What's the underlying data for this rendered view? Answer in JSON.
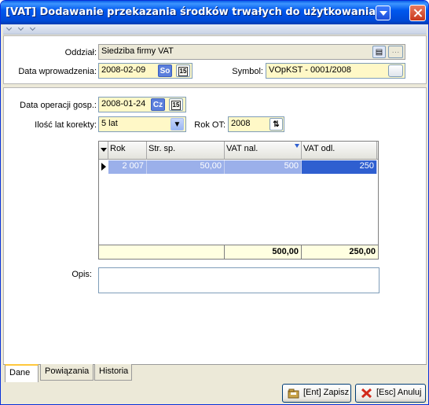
{
  "window": {
    "title": "[VAT] Dodawanie przekazania środków trwałych do użytkowania z inwestycji"
  },
  "header": {
    "oddzial_label": "Oddział:",
    "oddzial_value": "Siedziba firmy VAT",
    "data_wprowadzenia_label": "Data wprowadzenia:",
    "data_wprowadzenia_value": "2008-02-09",
    "data_wprowadzenia_tag": "So",
    "symbol_label": "Symbol:",
    "symbol_value": "VOpKST - 0001/2008"
  },
  "main": {
    "data_operacji_label": "Data operacji gosp.:",
    "data_operacji_value": "2008-01-24",
    "data_operacji_tag": "Cz",
    "ilosc_lat_label": "Ilość lat korekty:",
    "ilosc_lat_value": "5 lat",
    "rok_ot_label": "Rok OT:",
    "rok_ot_value": "2008",
    "opis_label": "Opis:",
    "opis_value": ""
  },
  "grid": {
    "columns": [
      "Rok",
      "Str. sp.",
      "VAT nal.",
      "VAT odl."
    ],
    "rows": [
      {
        "rok": "2 007",
        "str_sp": "50,00",
        "vat_nal": "500",
        "vat_odl": "250"
      }
    ],
    "totals": {
      "vat_nal": "500,00",
      "vat_odl": "250,00"
    }
  },
  "tabs": [
    "Dane",
    "Powiązania",
    "Historia"
  ],
  "buttons": {
    "save": "[Ent] Zapisz",
    "cancel": "[Esc] Anuluj"
  },
  "colors": {
    "titlebar": "#0058ee",
    "required_field": "#fff8c7",
    "grid_selected": "#9bb0ea",
    "totals_row": "#ffffe1"
  }
}
